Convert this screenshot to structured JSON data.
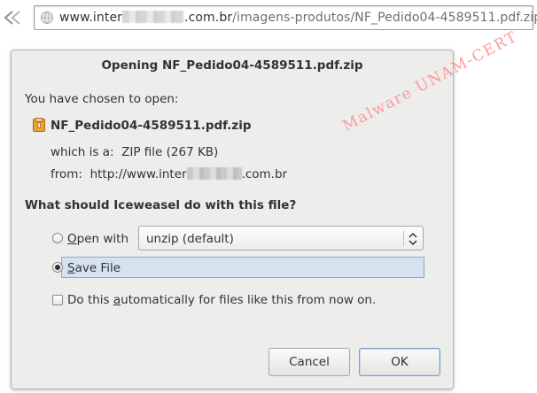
{
  "browser": {
    "url_prefix": "www.inter",
    "url_host_suffix": ".com.br",
    "url_path": "/imagens-produtos/NF_Pedido04-4589511.pdf.zip"
  },
  "dialog": {
    "title": "Opening NF_Pedido04-4589511.pdf.zip",
    "chosen_label": "You have chosen to open:",
    "filename": "NF_Pedido04-4589511.pdf.zip",
    "which_is_label": "which is a:",
    "file_type": "ZIP file (267 KB)",
    "from_label": "from:",
    "from_prefix": "http://www.inter",
    "from_suffix": ".com.br",
    "question": "What should Iceweasel do with this file?",
    "open_with_prefix": "O",
    "open_with_rest": "pen with",
    "open_with_app": "unzip (default)",
    "save_file_prefix": "S",
    "save_file_rest": "ave File",
    "auto_before": "Do this ",
    "auto_ul": "a",
    "auto_after": "utomatically for files like this from now on.",
    "cancel_label": "Cancel",
    "ok_label": "OK"
  },
  "watermark": "Malware UNAM-CERT",
  "colors": {
    "dialog_bg": "#ededec",
    "selected_row": "#d6e2ef",
    "watermark": "#ff8a8a"
  }
}
